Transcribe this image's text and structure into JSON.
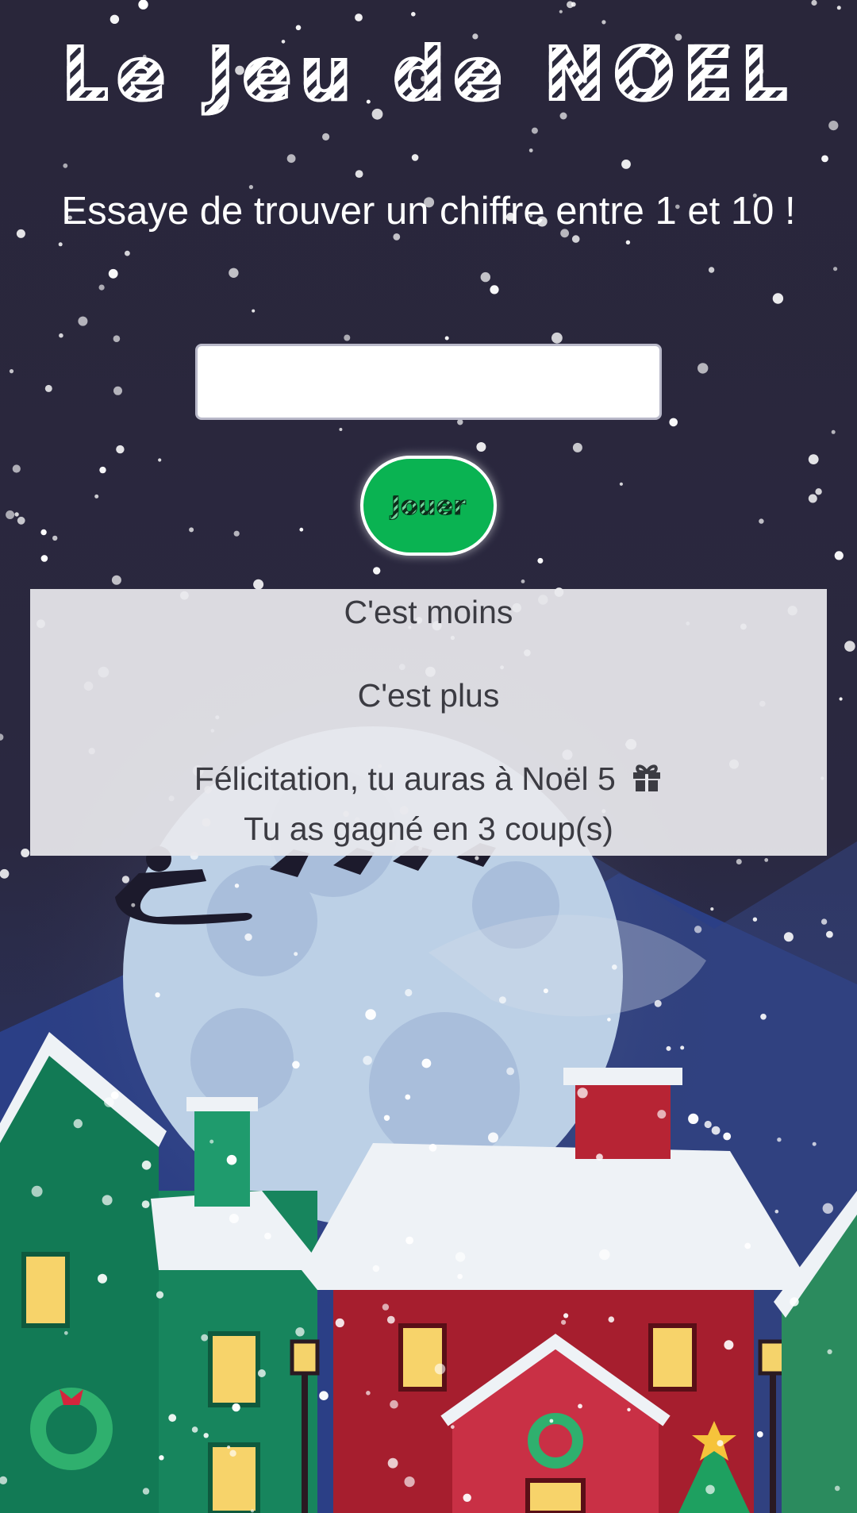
{
  "header": {
    "title": "Le Jeu de NOEL",
    "subtitle": "Essaye de trouver un chiffre entre 1 et 10 !"
  },
  "form": {
    "input_value": "",
    "input_placeholder": "",
    "play_label": "Jouer"
  },
  "results": {
    "lower_message": "C'est moins",
    "higher_message": "C'est plus",
    "win_message": "Félicitation, tu auras à Noël 5",
    "win_icon": "gift-icon",
    "attempts_message": "Tu as gagné en 3 coup(s)"
  },
  "colors": {
    "night_sky": "#29263a",
    "play_button": "#0ab352",
    "panel": "#e8e8ed"
  }
}
